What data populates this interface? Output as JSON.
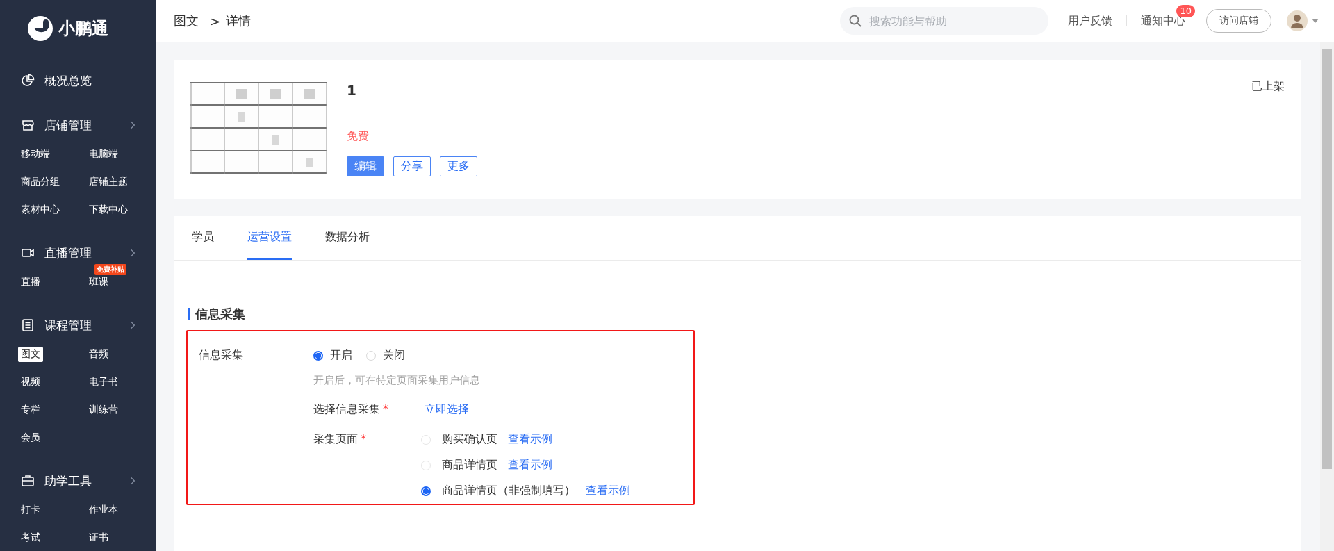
{
  "sidebar": {
    "logo": "小鹏通",
    "groups": [
      {
        "label": "概况总览",
        "expandable": false
      },
      {
        "label": "店铺管理",
        "expandable": true,
        "items": [
          {
            "label": "移动端",
            "selected": false
          },
          {
            "label": "电脑端",
            "selected": false
          },
          {
            "label": "商品分组",
            "selected": false
          },
          {
            "label": "店铺主题",
            "selected": false
          },
          {
            "label": "素材中心",
            "selected": false
          },
          {
            "label": "下载中心",
            "selected": false
          }
        ]
      },
      {
        "label": "直播管理",
        "expandable": true,
        "items": [
          {
            "label": "直播",
            "selected": false
          },
          {
            "label": "班课",
            "selected": false,
            "badge": "免费补贴"
          }
        ]
      },
      {
        "label": "课程管理",
        "expandable": true,
        "items": [
          {
            "label": "图文",
            "selected": true
          },
          {
            "label": "音频",
            "selected": false
          },
          {
            "label": "视频",
            "selected": false
          },
          {
            "label": "电子书",
            "selected": false
          },
          {
            "label": "专栏",
            "selected": false
          },
          {
            "label": "训练营",
            "selected": false
          },
          {
            "label": "会员",
            "selected": false
          }
        ]
      },
      {
        "label": "助学工具",
        "expandable": true,
        "items": [
          {
            "label": "打卡",
            "selected": false
          },
          {
            "label": "作业本",
            "selected": false
          },
          {
            "label": "考试",
            "selected": false
          },
          {
            "label": "证书",
            "selected": false
          }
        ]
      }
    ]
  },
  "topbar": {
    "breadcrumb": [
      "图文",
      "详情"
    ],
    "separator": ">",
    "search": {
      "placeholder": "搜索功能与帮助"
    },
    "feedback": "用户反馈",
    "notifications": {
      "label": "通知中心",
      "count": "10"
    },
    "visit_button": "访问店铺"
  },
  "product": {
    "title": "1",
    "price": "免费",
    "status": "已上架",
    "buttons": [
      {
        "label": "编辑",
        "primary": true
      },
      {
        "label": "分享",
        "primary": false
      },
      {
        "label": "更多",
        "primary": false
      }
    ]
  },
  "tabs": [
    {
      "label": "学员",
      "selected": false
    },
    {
      "label": "运营设置",
      "selected": true
    },
    {
      "label": "数据分析",
      "selected": false
    }
  ],
  "section": {
    "title": "信息采集",
    "highlighted": true,
    "toggle": {
      "label": "信息采集",
      "options": [
        {
          "label": "开启",
          "selected": true
        },
        {
          "label": "关闭",
          "selected": false
        }
      ],
      "hint": "开启后，可在特定页面采集用户信息"
    },
    "select": {
      "label": "选择信息采集",
      "required_mark": "*",
      "link": "立即选择"
    },
    "pages": {
      "label": "采集页面",
      "required_mark": "*",
      "options": [
        {
          "label": "购买确认页",
          "selected": false,
          "link": "查看示例"
        },
        {
          "label": "商品详情页",
          "selected": false,
          "link": "查看示例"
        },
        {
          "label": "商品详情页（非强制填写）",
          "selected": true,
          "link": "查看示例"
        }
      ]
    }
  }
}
